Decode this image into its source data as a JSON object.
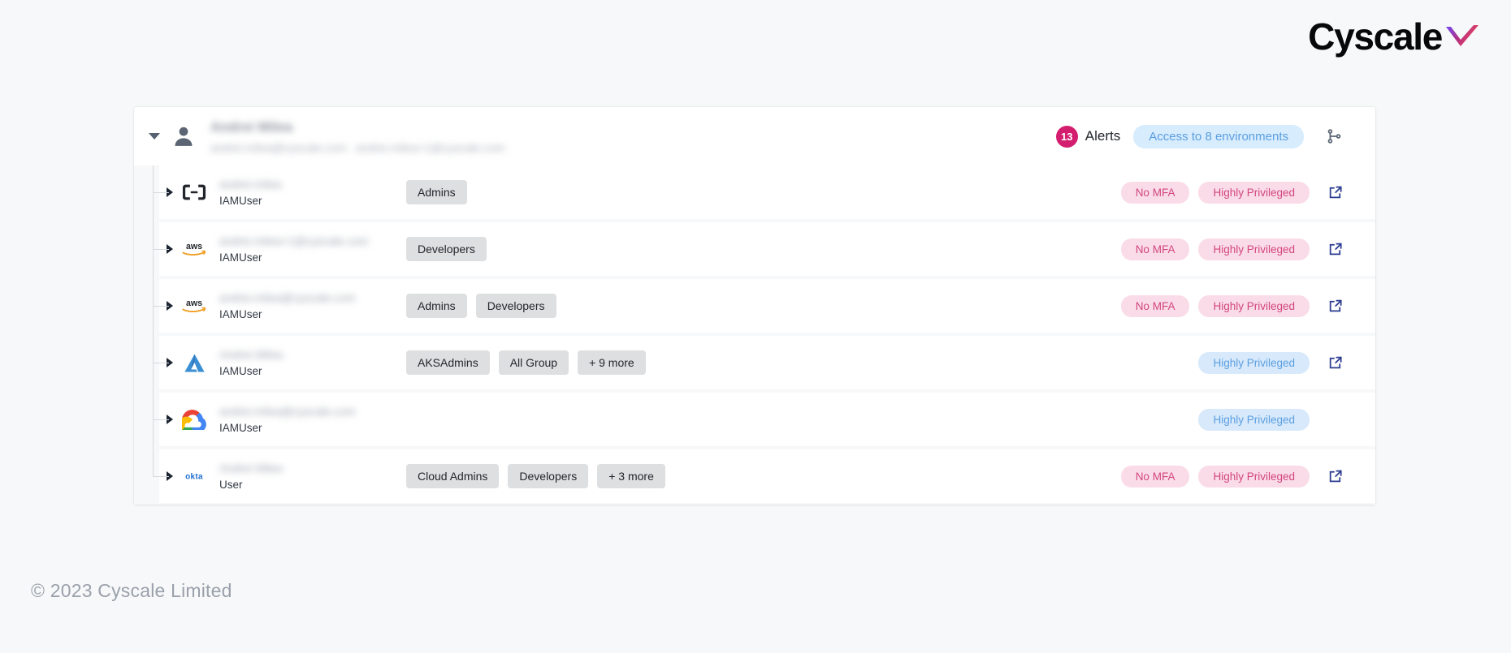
{
  "brand": {
    "name": "Cyscale",
    "mark_colors": [
      "#6d4aff",
      "#e0336a"
    ]
  },
  "colors": {
    "accent_pink": "#d31d6e",
    "tag_danger_bg": "#fadce8",
    "tag_danger_text": "#d2467e",
    "tag_info_bg": "#d7e9fb",
    "tag_info_text": "#5b9fe0",
    "chip_bg": "#dddfe1",
    "link_blue": "#2a3b8f",
    "page_bg": "#f7f8f9"
  },
  "user_header": {
    "caret_state": "expanded",
    "name": "Andrei Milea",
    "emails": "andrei.milea@cyscale.com . andrei.milea+1@cyscale.com",
    "alerts_count": "13",
    "alerts_label": "Alerts",
    "environments_pill": "Access to 8 environments",
    "branch_icon": "branch-graph-icon",
    "avatar_icon": "user-avatar-icon"
  },
  "rows": [
    {
      "provider": "alibaba-cloud-icon",
      "identity_name": "andrei.milea",
      "identity_type": "IAMUser",
      "groups": [
        "Admins"
      ],
      "tags": [
        {
          "label": "No MFA",
          "style": "danger"
        },
        {
          "label": "Highly Privileged",
          "style": "danger"
        }
      ],
      "has_external_link": true
    },
    {
      "provider": "aws-icon",
      "identity_name": "andrei.milea+1@cyscale.com",
      "identity_type": "IAMUser",
      "groups": [
        "Developers"
      ],
      "tags": [
        {
          "label": "No MFA",
          "style": "danger"
        },
        {
          "label": "Highly Privileged",
          "style": "danger"
        }
      ],
      "has_external_link": true
    },
    {
      "provider": "aws-icon",
      "identity_name": "andrei.milea@cyscale.com",
      "identity_type": "IAMUser",
      "groups": [
        "Admins",
        "Developers"
      ],
      "tags": [
        {
          "label": "No MFA",
          "style": "danger"
        },
        {
          "label": "Highly Privileged",
          "style": "danger"
        }
      ],
      "has_external_link": true
    },
    {
      "provider": "azure-icon",
      "identity_name": "Andrei Milea",
      "identity_type": "IAMUser",
      "groups": [
        "AKSAdmins",
        "All Group",
        "+ 9 more"
      ],
      "tags": [
        {
          "label": "Highly Privileged",
          "style": "info"
        }
      ],
      "has_external_link": true
    },
    {
      "provider": "google-cloud-icon",
      "identity_name": "andrei.milea@cyscale.com",
      "identity_type": "IAMUser",
      "groups": [],
      "tags": [
        {
          "label": "Highly Privileged",
          "style": "info"
        }
      ],
      "has_external_link": false
    },
    {
      "provider": "okta-icon",
      "identity_name": "Andrei Milea",
      "identity_type": "User",
      "groups": [
        "Cloud Admins",
        "Developers",
        "+ 3 more"
      ],
      "tags": [
        {
          "label": "No MFA",
          "style": "danger"
        },
        {
          "label": "Highly Privileged",
          "style": "danger"
        }
      ],
      "has_external_link": true
    }
  ],
  "footer": {
    "copyright": "© 2023 Cyscale Limited"
  }
}
